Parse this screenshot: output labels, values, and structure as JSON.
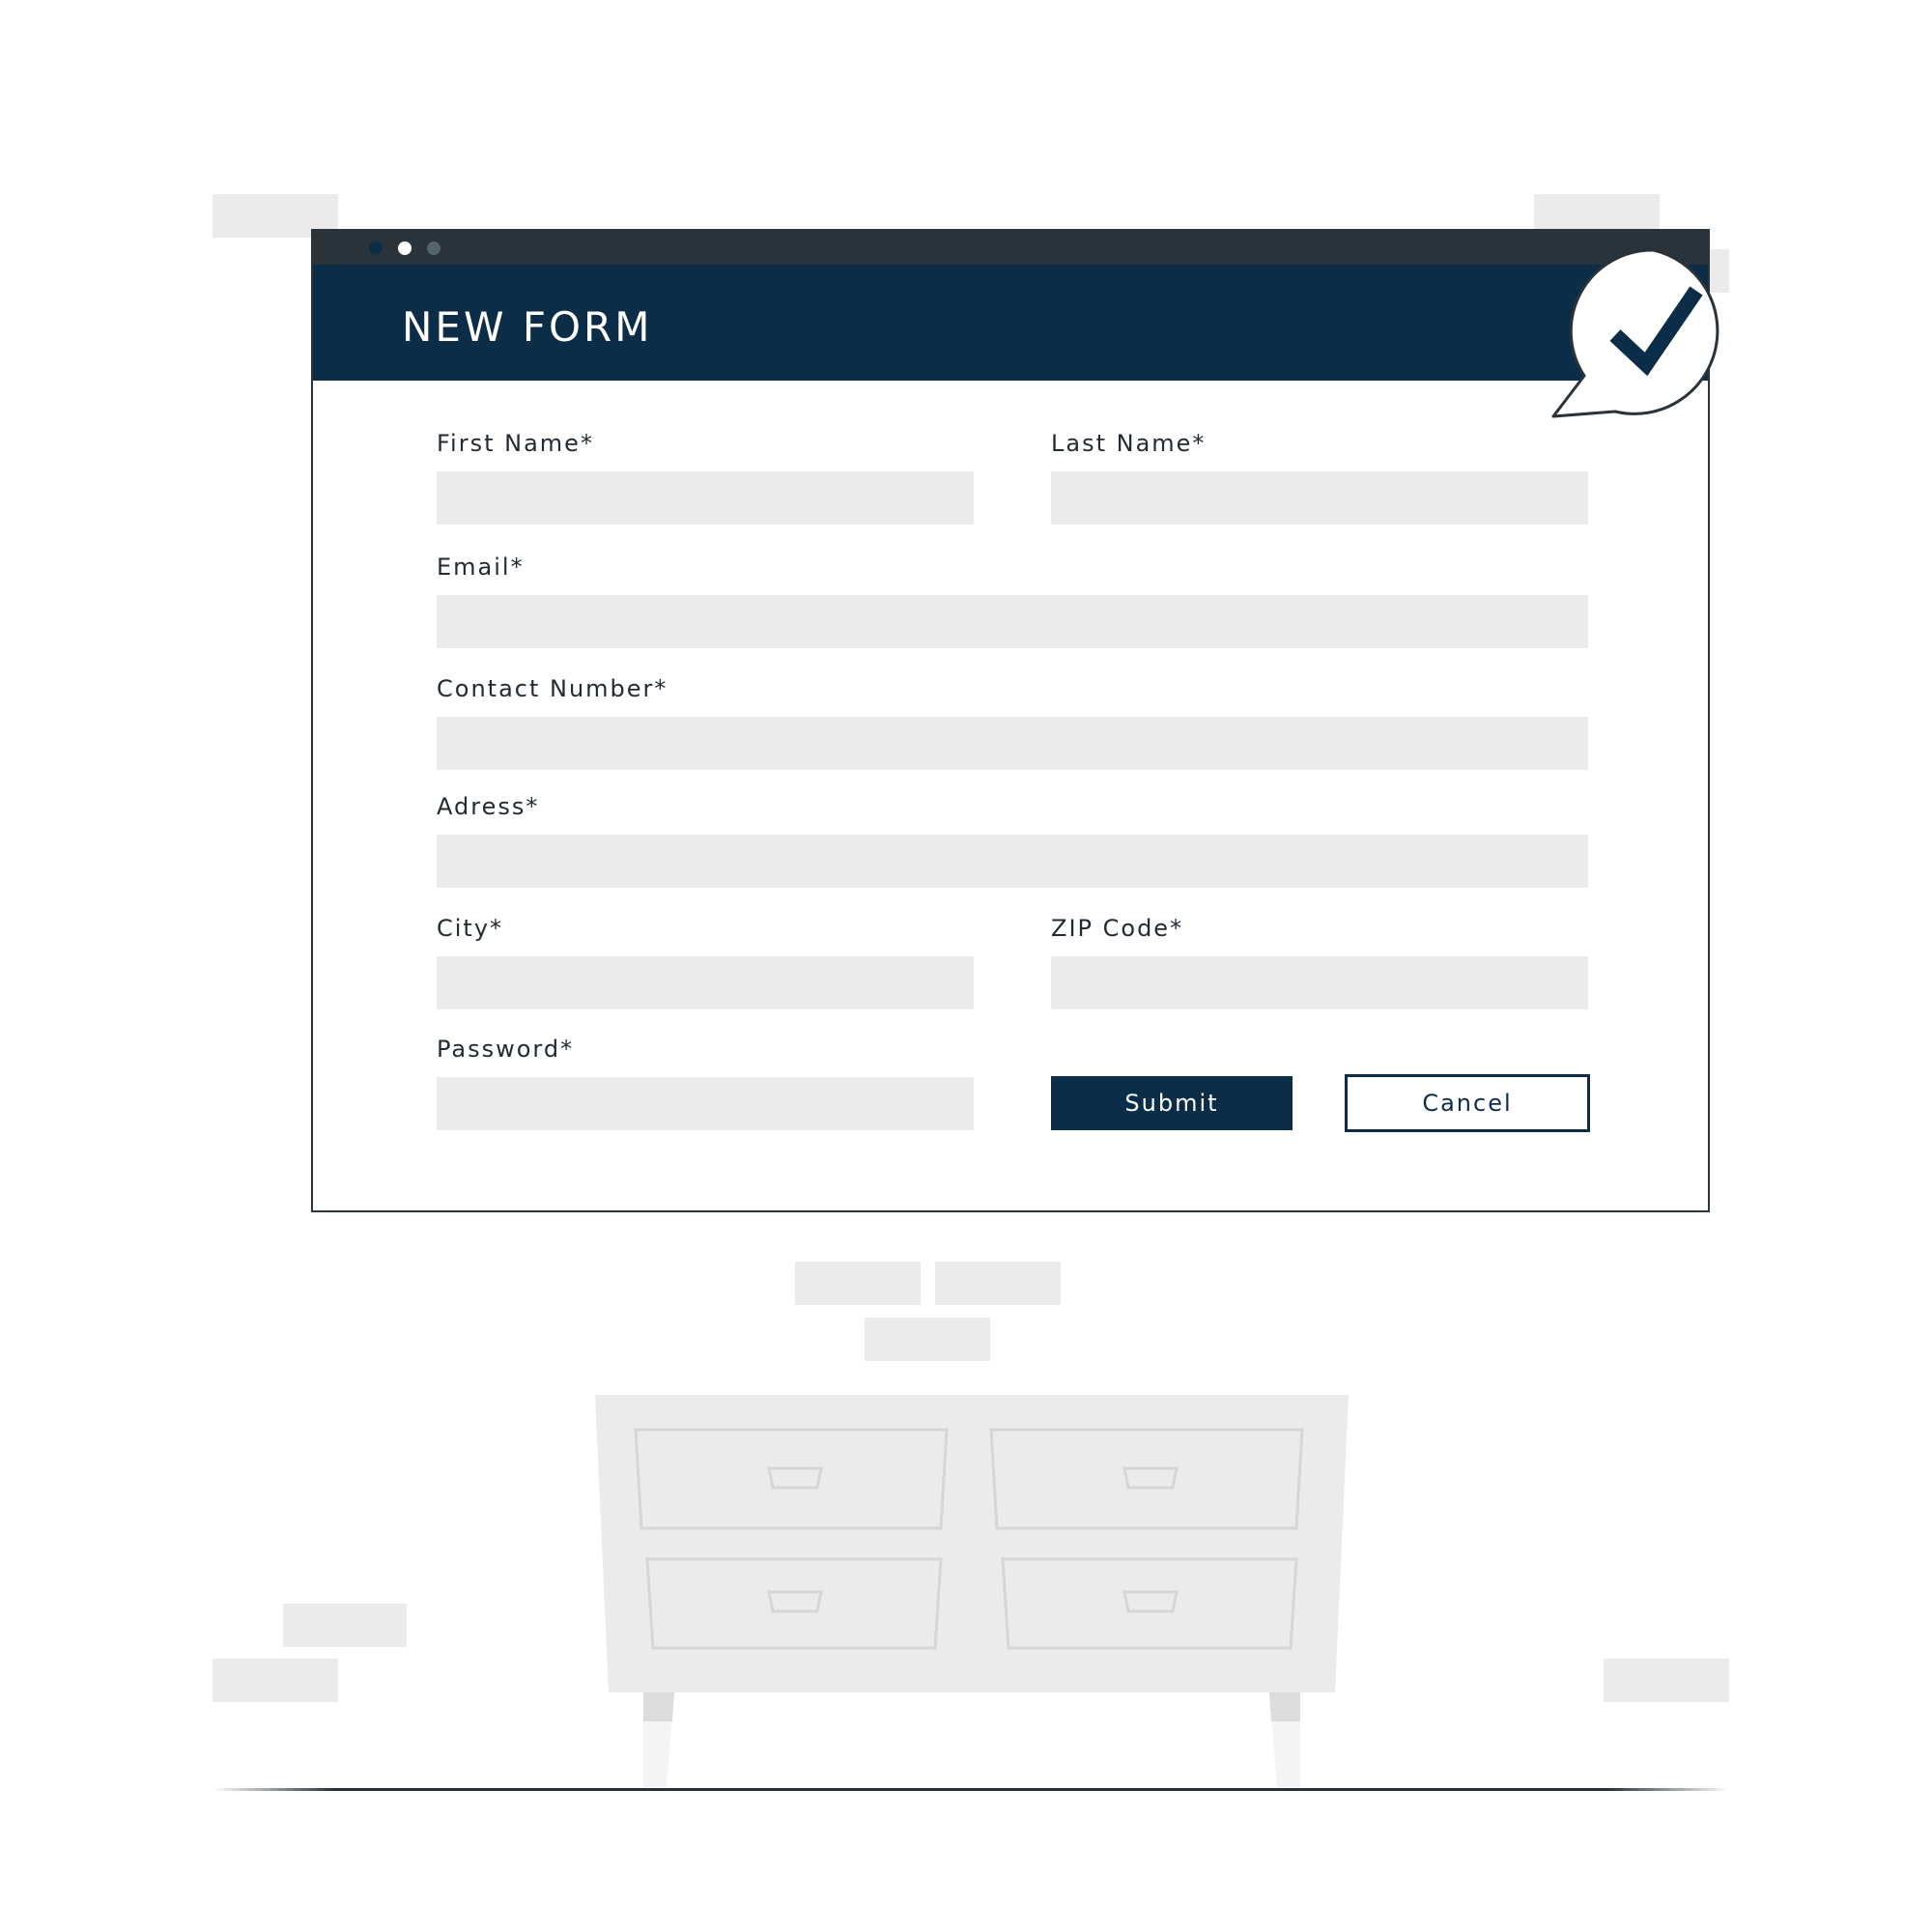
{
  "form": {
    "title": "NEW FORM",
    "fields": {
      "first_name": {
        "label": "First Name*",
        "value": ""
      },
      "last_name": {
        "label": "Last Name*",
        "value": ""
      },
      "email": {
        "label": "Email*",
        "value": ""
      },
      "contact_number": {
        "label": "Contact Number*",
        "value": ""
      },
      "address": {
        "label": "Adress*",
        "value": ""
      },
      "city": {
        "label": "City*",
        "value": ""
      },
      "zip_code": {
        "label": "ZIP Code*",
        "value": ""
      },
      "password": {
        "label": "Password*",
        "value": ""
      }
    },
    "buttons": {
      "submit": "Submit",
      "cancel": "Cancel"
    }
  },
  "icons": {
    "window_controls": [
      "window-dot-icon",
      "window-dot-icon",
      "window-dot-icon"
    ],
    "badge": "checkmark-icon"
  },
  "colors": {
    "primary": "#0c2d48",
    "titlebar": "#2a3339",
    "input_background": "#ebebeb",
    "brick": "#ebebeb",
    "dresser": "#ebebeb"
  }
}
